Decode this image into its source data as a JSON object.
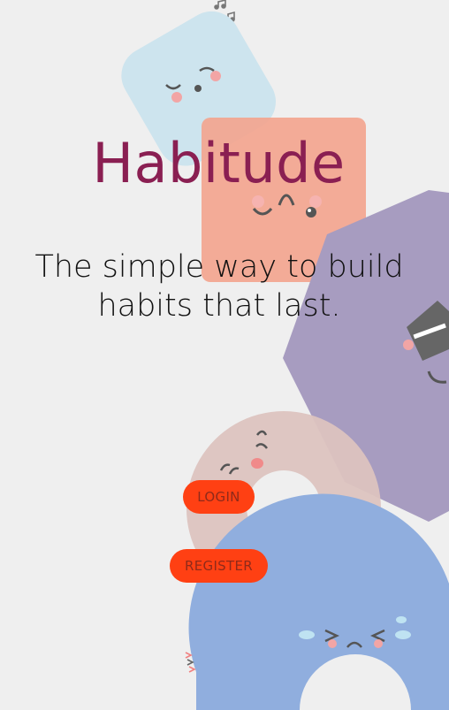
{
  "app": {
    "title": "Habitude",
    "tagline": "The simple way to build habits that last."
  },
  "actions": {
    "login_label": "LOGIN",
    "register_label": "REGISTER"
  },
  "colors": {
    "background": "#efefef",
    "title": "#8a1f52",
    "button": "#ff4013",
    "button_text": "#8f2a1a"
  }
}
